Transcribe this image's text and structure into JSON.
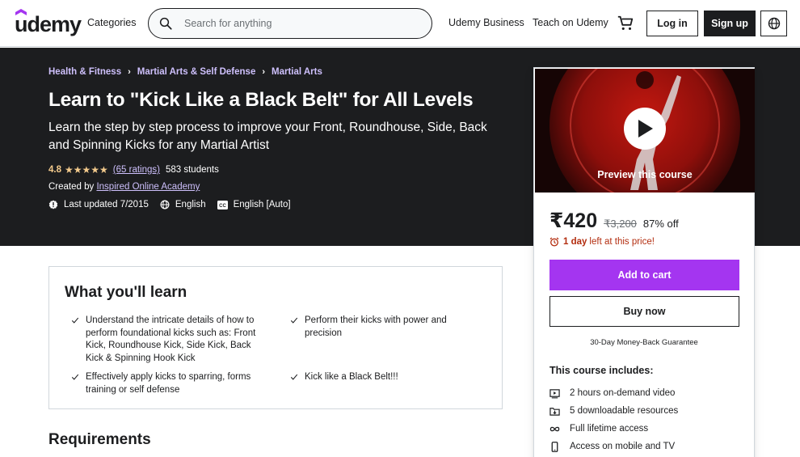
{
  "header": {
    "logo_text": "udemy",
    "categories_label": "Categories",
    "search_placeholder": "Search for anything",
    "business_label": "Udemy Business",
    "teach_label": "Teach on Udemy",
    "login_label": "Log in",
    "signup_label": "Sign up"
  },
  "breadcrumbs": [
    "Health & Fitness",
    "Martial Arts & Self Defense",
    "Martial Arts"
  ],
  "course": {
    "title": "Learn to \"Kick Like a Black Belt\" for All Levels",
    "subtitle": "Learn the step by step process to improve your Front, Roundhouse, Side, Back and Spinning Kicks for any Martial Artist",
    "rating": "4.8",
    "stars": "★★★★★",
    "rating_count": "(65 ratings)",
    "students": "583 students",
    "created_by_label": "Created by",
    "instructor": "Inspired Online Academy",
    "last_updated": "Last updated 7/2015",
    "language": "English",
    "captions": "English [Auto]"
  },
  "sidebar": {
    "preview_label": "Preview this course",
    "price": "₹420",
    "original_price": "₹3,200",
    "discount": "87% off",
    "time_left_bold": "1 day",
    "time_left_text": "left at this price!",
    "add_to_cart": "Add to cart",
    "buy_now": "Buy now",
    "guarantee": "30-Day Money-Back Guarantee",
    "includes_title": "This course includes:",
    "includes": [
      {
        "icon": "video-icon",
        "text": "2 hours on-demand video"
      },
      {
        "icon": "file-download-icon",
        "text": "5 downloadable resources"
      },
      {
        "icon": "infinity-icon",
        "text": "Full lifetime access"
      },
      {
        "icon": "mobile-icon",
        "text": "Access on mobile and TV"
      }
    ]
  },
  "learn": {
    "title": "What you'll learn",
    "items": [
      "Understand the intricate details of how to perform foundational kicks such as: Front Kick, Roundhouse Kick, Side Kick, Back Kick & Spinning Hook Kick",
      "Perform their kicks with power and precision",
      "Effectively apply kicks to sparring, forms training or self defense",
      "Kick like a Black Belt!!!"
    ]
  },
  "requirements": {
    "title": "Requirements"
  },
  "colors": {
    "accent": "#a435f0",
    "hero_bg": "#1c1d1f",
    "link_purple": "#cec0fc",
    "star_gold": "#f3ca8c",
    "timer_red": "#b32d0f"
  }
}
